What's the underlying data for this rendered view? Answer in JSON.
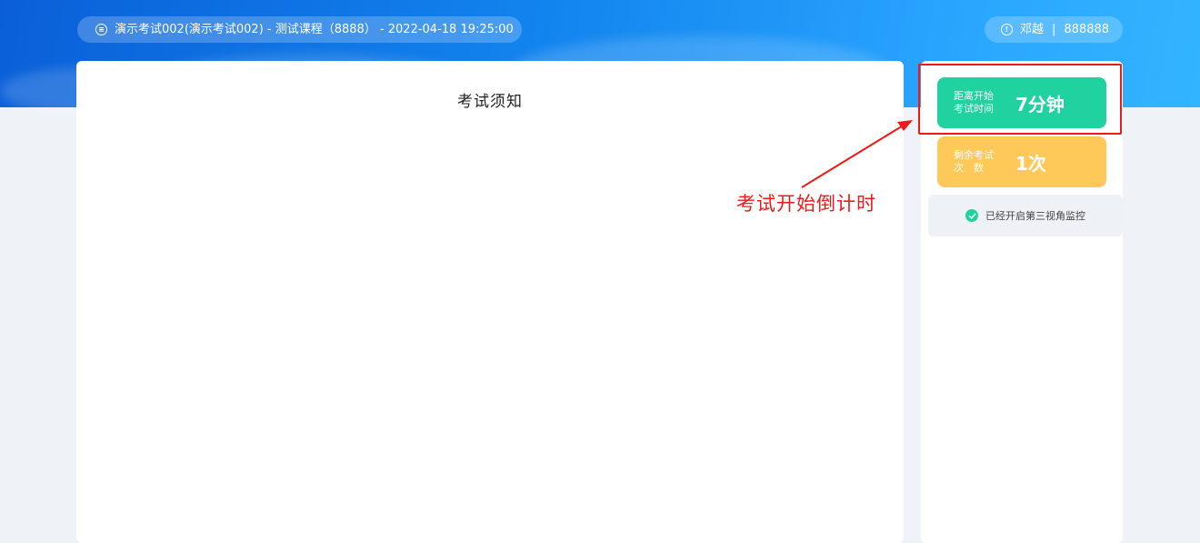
{
  "header": {
    "exam_info": "演示考试002(演示考试002) - 测试课程（8888） - 2022-04-18 19:25:00",
    "exam_icon": "list-circle-icon",
    "user_icon": "user-circle-icon",
    "user_name": "邓越",
    "user_separator": "|",
    "user_id": "888888"
  },
  "notice": {
    "title": "考试须知"
  },
  "sidebar": {
    "countdown_label_line1": "距离开始",
    "countdown_label_line2": "考试时间",
    "countdown_value": "7分钟",
    "attempts_label_line1": "剩余考试",
    "attempts_label_line2": "次　数",
    "attempts_value": "1次",
    "monitor_text": "已经开启第三视角监控",
    "monitor_icon": "check-circle-icon"
  },
  "annotation": {
    "label": "考试开始倒计时"
  },
  "colors": {
    "header_blue": "#1284ee",
    "countdown_green": "#1fd29f",
    "attempts_yellow": "#ffc95a",
    "annotation_red": "#f01818"
  }
}
